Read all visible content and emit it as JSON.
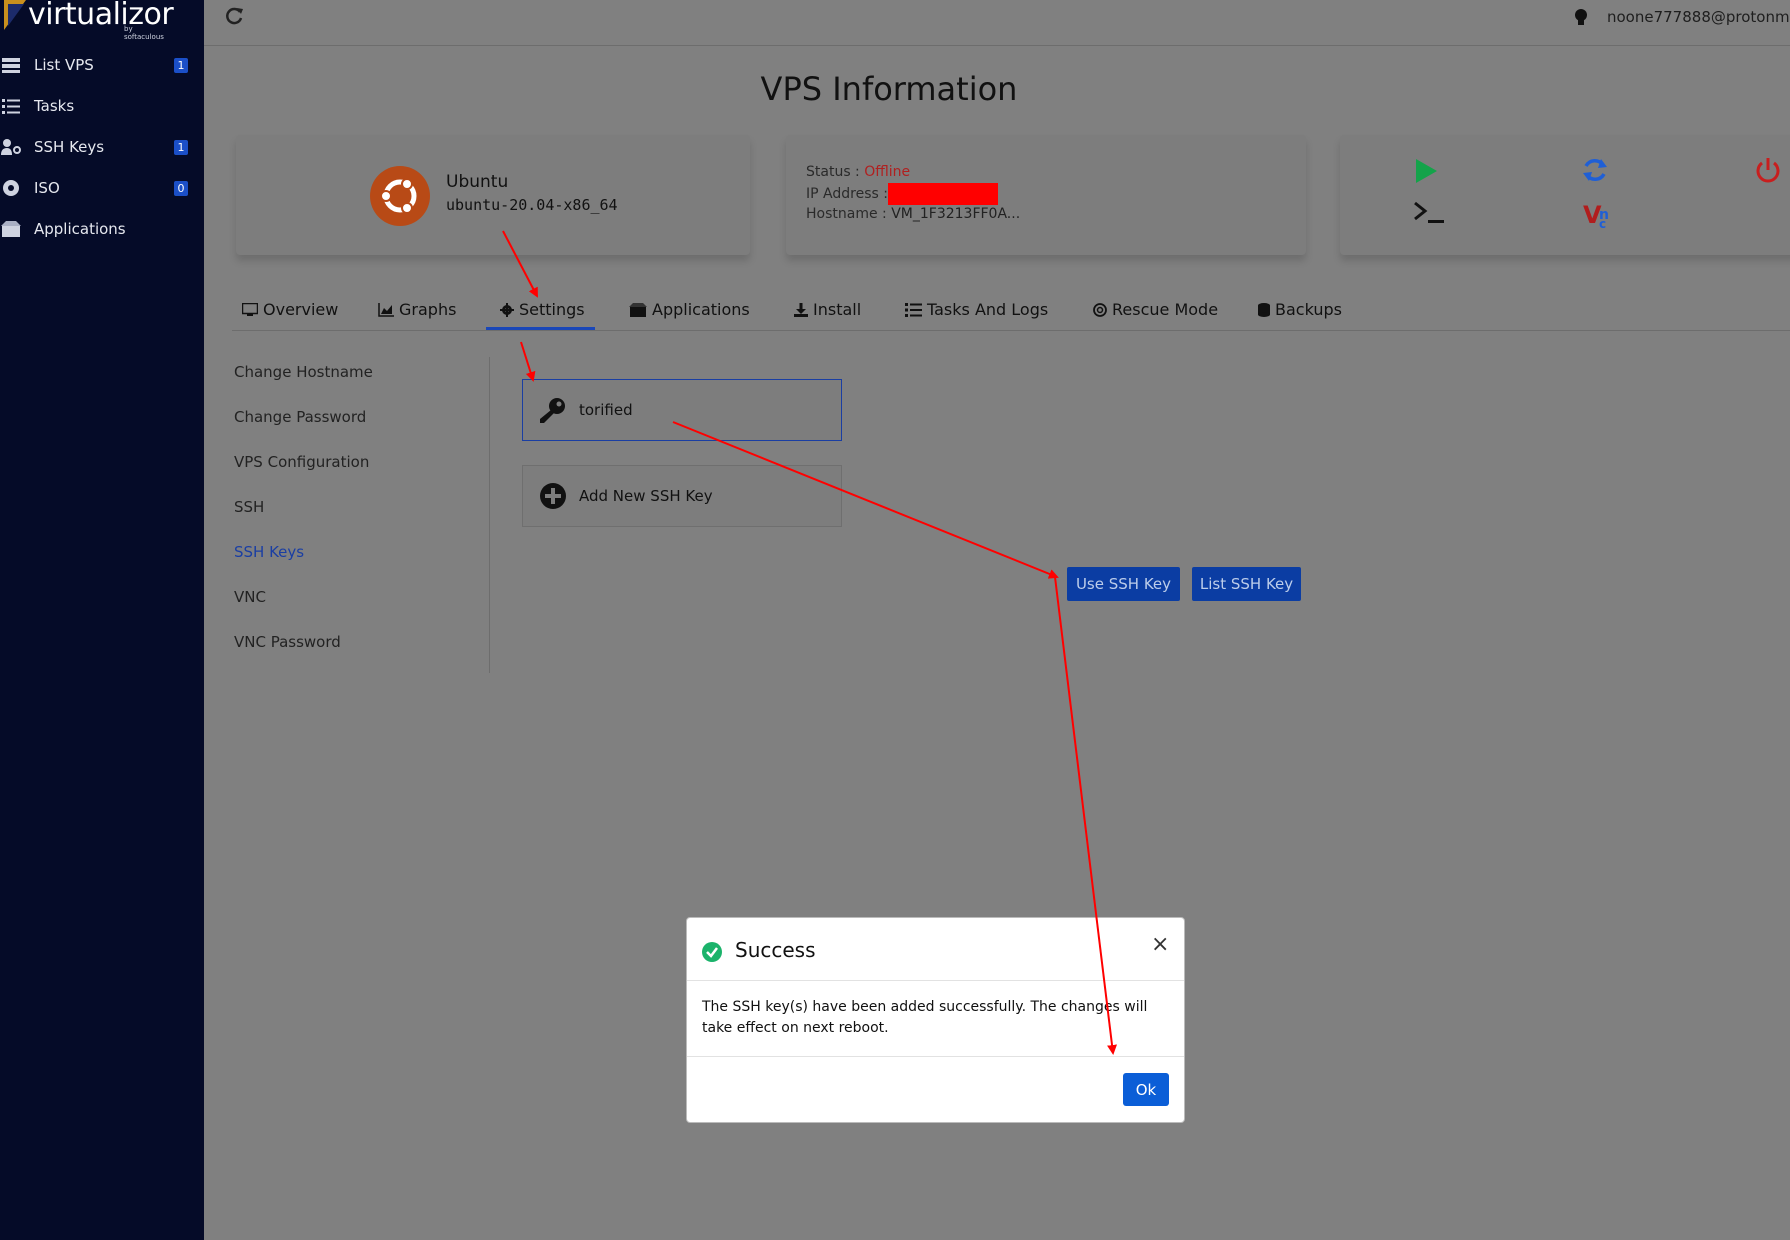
{
  "brand": {
    "name": "virtualizor",
    "sub": "by softaculous"
  },
  "sidebar": {
    "items": [
      {
        "label": "List VPS",
        "badge": "1",
        "icon": "server-list-icon"
      },
      {
        "label": "Tasks",
        "badge": "",
        "icon": "tasks-icon"
      },
      {
        "label": "SSH Keys",
        "badge": "1",
        "icon": "user-key-icon"
      },
      {
        "label": "ISO",
        "badge": "0",
        "icon": "disc-icon"
      },
      {
        "label": "Applications",
        "badge": "",
        "icon": "box-icon"
      }
    ]
  },
  "topbar": {
    "user": "noone777888@protonm"
  },
  "page": {
    "title": "VPS Information"
  },
  "vps": {
    "os_name": "Ubuntu",
    "os_version": "ubuntu-20.04-x86_64",
    "status_label": "Status :",
    "status_value": "Offline",
    "ip_label": "IP Address :",
    "hostname_label": "Hostname :",
    "hostname_value": "VM_1F3213FF0A..."
  },
  "actions": [
    {
      "icon": "play-icon",
      "color": "#14a34a"
    },
    {
      "icon": "restart-icon",
      "color": "#1f5fd6"
    },
    {
      "icon": "power-icon",
      "color": "#c81e1e"
    },
    {
      "icon": "terminal-icon",
      "color": "#111111"
    },
    {
      "icon": "vnc-icon",
      "color": "#b11d1d"
    }
  ],
  "tabs": [
    {
      "label": "Overview",
      "icon": "monitor-icon"
    },
    {
      "label": "Graphs",
      "icon": "chart-icon"
    },
    {
      "label": "Settings",
      "icon": "gear-icon",
      "active": true
    },
    {
      "label": "Applications",
      "icon": "boxes-icon"
    },
    {
      "label": "Install",
      "icon": "download-icon"
    },
    {
      "label": "Tasks And Logs",
      "icon": "list-check-icon"
    },
    {
      "label": "Rescue Mode",
      "icon": "lifebuoy-icon"
    },
    {
      "label": "Backups",
      "icon": "database-icon"
    }
  ],
  "settings_nav": [
    {
      "label": "Change Hostname"
    },
    {
      "label": "Change Password"
    },
    {
      "label": "VPS Configuration"
    },
    {
      "label": "SSH"
    },
    {
      "label": "SSH Keys",
      "active": true
    },
    {
      "label": "VNC"
    },
    {
      "label": "VNC Password"
    }
  ],
  "ssh_keys": {
    "key_name": "torified",
    "add_label": "Add New SSH Key",
    "use_button": "Use SSH Key",
    "list_button": "List SSH Key"
  },
  "modal": {
    "title": "Success",
    "message": "The SSH key(s) have been added successfully. The changes will take effect on next reboot.",
    "close": "×",
    "ok": "Ok"
  },
  "colors": {
    "sidebar_bg": "#050b28",
    "accent": "#0b3da3",
    "offline": "#b02020",
    "annotation": "#ff0000"
  }
}
